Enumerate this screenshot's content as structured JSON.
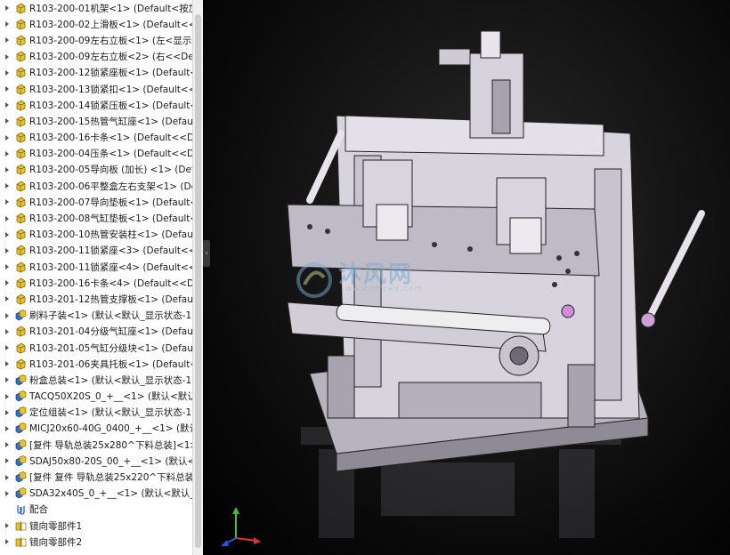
{
  "tree": {
    "items": [
      {
        "label": "R103-200-01机架<1> (Default<按加工",
        "icon": "part-icon"
      },
      {
        "label": "R103-200-02上滑板<1> (Default<<De",
        "icon": "part-icon"
      },
      {
        "label": "R103-200-09左右立板<1> (左<显示状",
        "icon": "part-icon"
      },
      {
        "label": "R103-200-09左右立板<2> (右<<Defau",
        "icon": "part-icon"
      },
      {
        "label": "R103-200-12锁紧座板<1> (Default<<",
        "icon": "part-icon"
      },
      {
        "label": "R103-200-13锁紧扣<1> (Default<<De",
        "icon": "part-icon"
      },
      {
        "label": "R103-200-14锁紧压板<1> (Default<<",
        "icon": "part-icon"
      },
      {
        "label": "R103-200-15热管气缸座<1> (Default<",
        "icon": "part-icon"
      },
      {
        "label": "R103-200-16卡条<1> (Default<<Defa",
        "icon": "part-icon"
      },
      {
        "label": "R103-200-04压条<1> (Default<<Defa",
        "icon": "part-icon"
      },
      {
        "label": "R103-200-05导向板 (加长) <1> (Def",
        "icon": "part-icon"
      },
      {
        "label": "R103-200-06平整盒左右支架<1> (Defa",
        "icon": "part-icon"
      },
      {
        "label": "R103-200-07导向垫板<1> (Default<<",
        "icon": "part-icon"
      },
      {
        "label": "R103-200-08气缸垫板<1> (Default<<",
        "icon": "part-icon"
      },
      {
        "label": "R103-200-10热管安装柱<1> (Default<",
        "icon": "part-icon"
      },
      {
        "label": "R103-200-11锁紧座<3> (Default<<De",
        "icon": "part-icon"
      },
      {
        "label": "R103-200-11锁紧座<4> (Default<<De",
        "icon": "part-icon"
      },
      {
        "label": "R103-200-16卡条<4> (Default<<Defa",
        "icon": "part-icon"
      },
      {
        "label": "R103-201-12热管支撑板<1> (Default<",
        "icon": "part-icon"
      },
      {
        "label": "刷料子装<1> (默认<默认_显示状态-1>)",
        "icon": "assembly-icon"
      },
      {
        "label": "R103-201-04分级气缸座<1> (Default<",
        "icon": "part-icon"
      },
      {
        "label": "R103-201-05气缸分级块<1> (Default<",
        "icon": "part-icon"
      },
      {
        "label": "R103-201-06夹具托板<1> (Default<<",
        "icon": "part-icon"
      },
      {
        "label": "粉盒总装<1> (默认<默认_显示状态-1>)",
        "icon": "assembly-icon"
      },
      {
        "label": "TACQ50X20S_0_+__<1> (默认<默认_显",
        "icon": "assembly-icon"
      },
      {
        "label": "定位组装<1> (默认<默认_显示状态-1>)",
        "icon": "assembly-icon"
      },
      {
        "label": "MICJ20x60-40G_0400_+__<1> (默认<",
        "icon": "assembly-icon"
      },
      {
        "label": "[复件 导轨总装25x280^下料总装]<1>",
        "icon": "assembly-icon"
      },
      {
        "label": "SDAJ50x80-20S_00_+__<1> (默认<默认",
        "icon": "assembly-icon"
      },
      {
        "label": "[复件 复件 导轨总装25x220^下料总装",
        "icon": "assembly-icon"
      },
      {
        "label": "SDA32x40S_0_+__<1> (默认<默认_显示",
        "icon": "assembly-icon"
      },
      {
        "label": "配合",
        "icon": "mates-icon"
      },
      {
        "label": "镜向零部件1",
        "icon": "mirror-icon"
      },
      {
        "label": "镜向零部件2",
        "icon": "mirror-icon"
      }
    ]
  },
  "viewport": {
    "watermark_text": "沐风网",
    "watermark_url": "www.mfcad.com"
  },
  "colors": {
    "part_yellow": "#e8c32a",
    "assembly_blue": "#2f6fd1",
    "machine_gray": "#c9c5cf",
    "background": "#000000"
  }
}
